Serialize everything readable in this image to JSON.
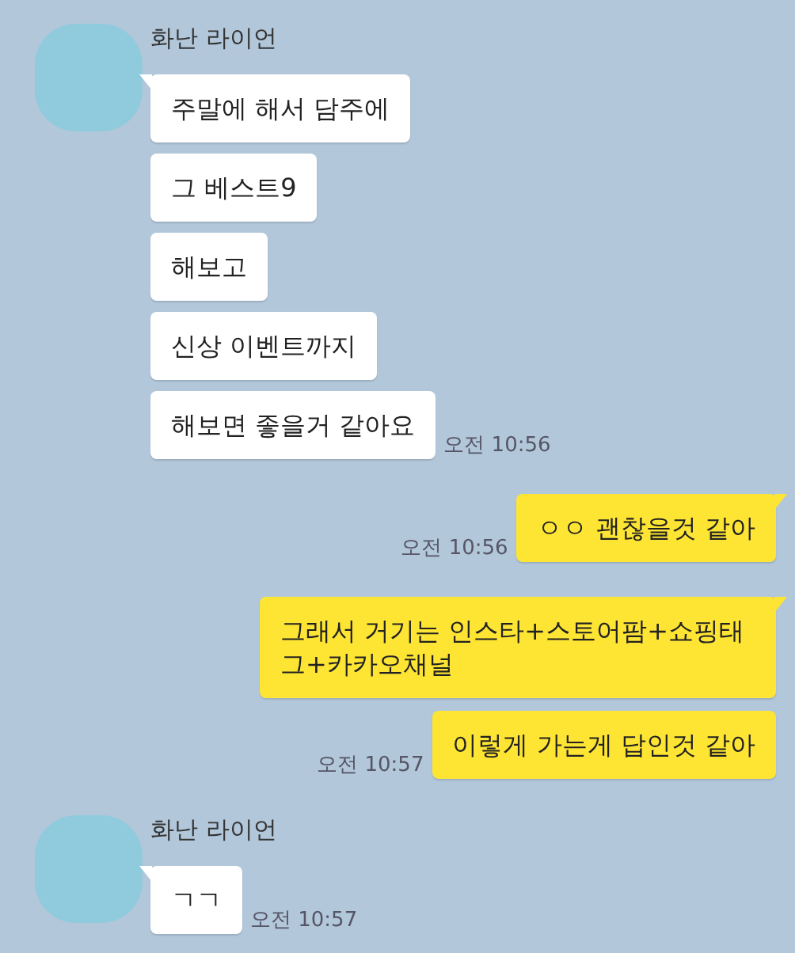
{
  "messages_groups": [
    {
      "kind": "received",
      "sender": "화난 라이언",
      "messages": [
        {
          "text": "주말에 해서 담주에"
        },
        {
          "text": "그 베스트9"
        },
        {
          "text": "해보고"
        },
        {
          "text": "신상 이벤트까지"
        },
        {
          "text": "해보면 좋을거 같아요",
          "time": "오전 10:56"
        }
      ]
    },
    {
      "kind": "sent",
      "messages": [
        {
          "text": "ㅇㅇ 괜찮을것 같아",
          "time": "오전 10:56"
        }
      ]
    },
    {
      "kind": "sent",
      "messages": [
        {
          "text": "그래서 거기는 인스타+스토어팜+쇼핑태그+카카오채널"
        },
        {
          "text": "이렇게 가는게 답인것 같아",
          "time": "오전 10:57"
        }
      ]
    },
    {
      "kind": "received",
      "sender": "화난 라이언",
      "messages": [
        {
          "text": "ㄱㄱ",
          "time": "오전 10:57"
        }
      ]
    }
  ]
}
